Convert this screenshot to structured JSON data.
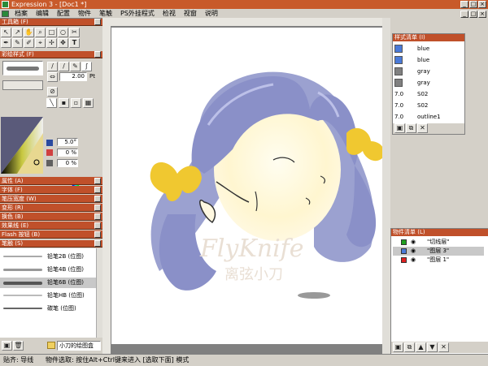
{
  "window": {
    "title": "Expression 3 - [Doc1 *]"
  },
  "menu": [
    "档案",
    "编辑",
    "配置",
    "物件",
    "笔触",
    "PS外挂程式",
    "检视",
    "视窗",
    "说明"
  ],
  "toolbox": {
    "title": "工具箱 (F)"
  },
  "style_panel": {
    "title": "彩绘样式 (F)",
    "size_value": "2.00",
    "size_unit": "Pt",
    "angle": "5.0°",
    "pct1": "0 %",
    "pct2": "0 %"
  },
  "collapsed_panels": [
    "属性 (A)",
    "字体 (F)",
    "笔压宽度 (W)",
    "变形 (R)",
    "换色 (B)",
    "效果线 (E)",
    "Flash 按钮 (B)"
  ],
  "brush_panel": {
    "title": "笔触 (S)",
    "items": [
      "铅笔2B (位图)",
      "铅笔4B (位图)",
      "铅笔6B (位图)",
      "铅笔HB (位图)",
      "碳笔 (位图)"
    ],
    "folder": "小刀的绘图盒"
  },
  "style_list": {
    "title": "样式清单 (I)",
    "items": [
      {
        "label": "blue",
        "color": "#4a7ad8"
      },
      {
        "label": "blue",
        "color": "#4a7ad8"
      },
      {
        "label": "gray",
        "color": "#808080"
      },
      {
        "label": "gray",
        "color": "#808080"
      },
      {
        "label": "S02",
        "size": "7.0"
      },
      {
        "label": "S02",
        "size": "7.0"
      },
      {
        "label": "outline1",
        "size": "7.0"
      }
    ]
  },
  "object_list": {
    "title": "物件清单 (L)",
    "items": [
      {
        "label": "\"切线层\"",
        "color": "#20a020"
      },
      {
        "label": "\"图层 3\"",
        "color": "#4a7ad8"
      },
      {
        "label": "\"图层 1\"",
        "color": "#e02020"
      }
    ]
  },
  "canvas": {
    "watermark_en": "FlyKnife",
    "watermark_cn": "离弦小刀"
  },
  "status": {
    "left": "贴齐: 导线",
    "right": "物件选取: 按住Alt+Ctrl键来进入 [选取下面] 模式"
  },
  "colors": {
    "accent": "#c0502a",
    "titlebar": "#c85a2a",
    "hair": "#8a90c8",
    "bow": "#f0c830",
    "face": "#fff8d8"
  }
}
